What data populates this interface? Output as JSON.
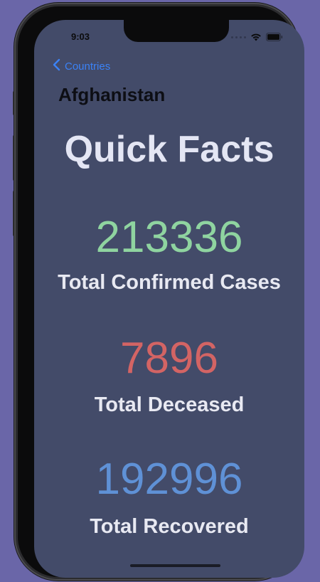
{
  "status_bar": {
    "time": "9:03",
    "icons": [
      "cellular-dots-icon",
      "wifi-icon",
      "battery-icon"
    ]
  },
  "nav": {
    "back_label": "Countries",
    "title": "Afghanistan"
  },
  "main": {
    "heading": "Quick Facts",
    "stats": [
      {
        "value": "213336",
        "label": "Total Confirmed Cases",
        "color": "#8fd4a0"
      },
      {
        "value": "7896",
        "label": "Total Deceased",
        "color": "#d36464"
      },
      {
        "value": "192996",
        "label": "Total Recovered",
        "color": "#5f91d6"
      }
    ]
  },
  "theme": {
    "background": "#6a66a8",
    "screen_background": "#434b69",
    "accent": "#3b82f6"
  }
}
